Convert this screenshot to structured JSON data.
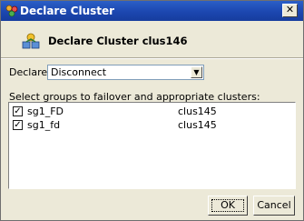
{
  "window": {
    "title": "Declare Cluster",
    "title_icon": "cluster-icon",
    "close_label": "✕"
  },
  "header": {
    "icon": "declare-cluster-icon",
    "text": "Declare Cluster clus146"
  },
  "declare": {
    "label": "Declare",
    "selected": "Disconnect"
  },
  "groups": {
    "label": "Select groups to failover and appropriate clusters:",
    "rows": [
      {
        "checked": true,
        "group": "sg1_FD",
        "cluster": "clus145"
      },
      {
        "checked": true,
        "group": "sg1_fd",
        "cluster": "clus145"
      }
    ]
  },
  "buttons": {
    "ok": "OK",
    "cancel": "Cancel"
  },
  "colors": {
    "titlebar": "#1c47b0",
    "face": "#ece9d8"
  }
}
